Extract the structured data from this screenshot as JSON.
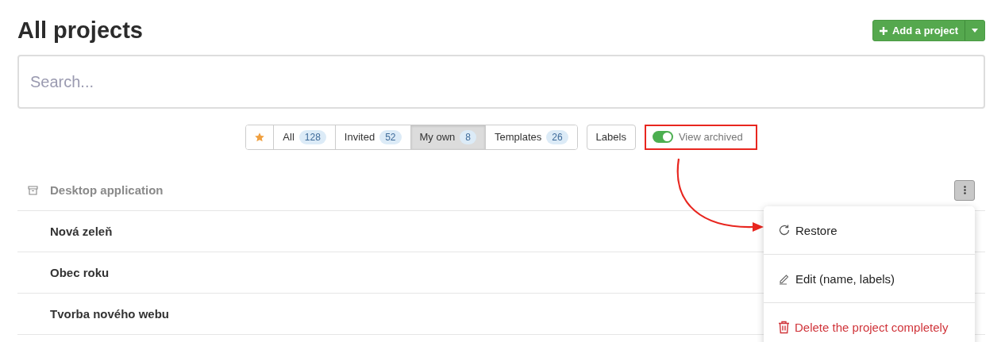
{
  "title": "All projects",
  "add_button": {
    "label": "Add a project"
  },
  "search": {
    "placeholder": "Search..."
  },
  "favorites_filter": {
    "selected": false
  },
  "filters": [
    {
      "label": "All",
      "count": "128",
      "selected": false
    },
    {
      "label": "Invited",
      "count": "52",
      "selected": false
    },
    {
      "label": "My own",
      "count": "8",
      "selected": true
    },
    {
      "label": "Templates",
      "count": "26",
      "selected": false
    }
  ],
  "labels_button": {
    "label": "Labels"
  },
  "archived_toggle": {
    "label": "View archived",
    "on": true,
    "highlighted": true
  },
  "projects": [
    {
      "name": "Desktop application",
      "archived": true,
      "menu_open": true
    },
    {
      "name": "Nová zeleň",
      "archived": false,
      "menu_open": false
    },
    {
      "name": "Obec roku",
      "archived": false,
      "menu_open": false
    },
    {
      "name": "Tvorba nového webu",
      "archived": false,
      "menu_open": false
    }
  ],
  "context_menu": [
    {
      "kind": "restore",
      "label": "Restore"
    },
    {
      "kind": "edit",
      "label": "Edit (name, labels)"
    },
    {
      "kind": "delete",
      "label": "Delete the project completely"
    }
  ]
}
